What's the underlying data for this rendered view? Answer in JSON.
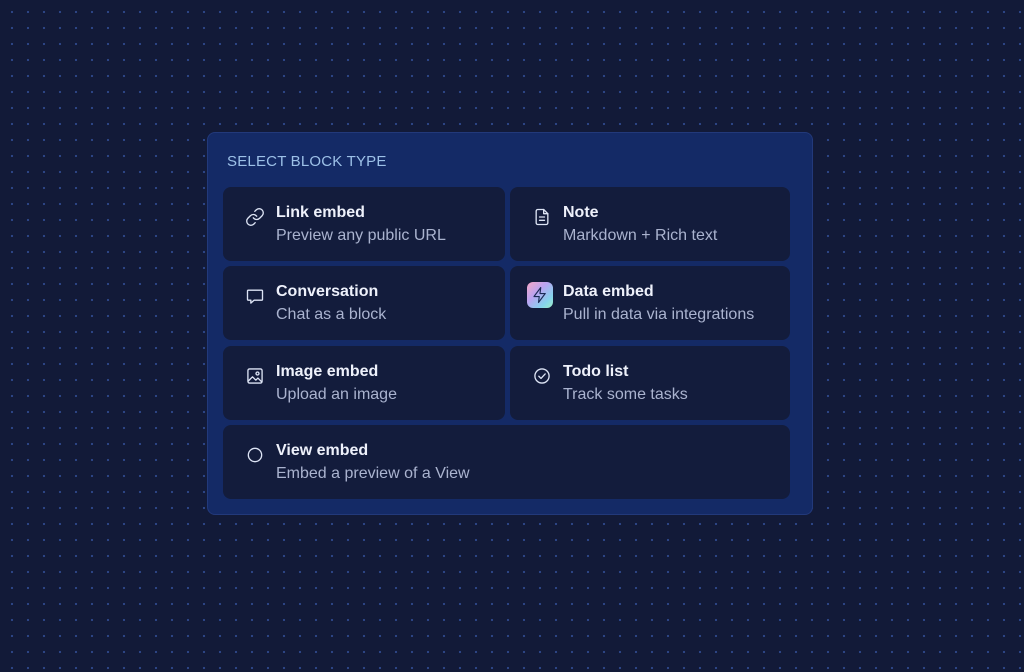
{
  "panel": {
    "title": "SELECT BLOCK TYPE"
  },
  "blocks": [
    {
      "icon": "link-icon",
      "title": "Link embed",
      "subtitle": "Preview any public URL"
    },
    {
      "icon": "note-icon",
      "title": "Note",
      "subtitle": "Markdown + Rich text"
    },
    {
      "icon": "chat-bubble-icon",
      "title": "Conversation",
      "subtitle": "Chat as a block"
    },
    {
      "icon": "lightning-icon",
      "title": "Data embed",
      "subtitle": "Pull in data via integrations"
    },
    {
      "icon": "image-icon",
      "title": "Image embed",
      "subtitle": "Upload an image"
    },
    {
      "icon": "check-circle-icon",
      "title": "Todo list",
      "subtitle": "Track some tasks"
    },
    {
      "icon": "circle-icon",
      "title": "View embed",
      "subtitle": "Embed a preview of a View"
    }
  ]
}
